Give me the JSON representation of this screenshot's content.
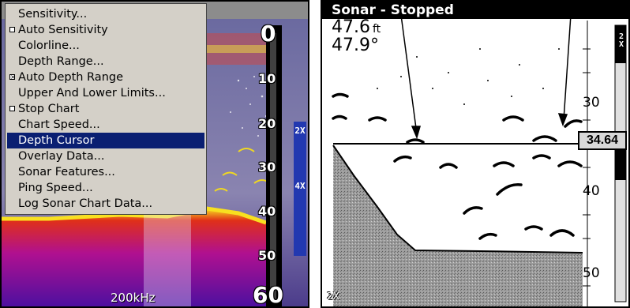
{
  "left": {
    "title": "",
    "menu": {
      "items": [
        {
          "label": "Sensitivity...",
          "checkbox": "",
          "selected": false
        },
        {
          "label": "Auto Sensitivity",
          "checkbox": "empty",
          "selected": false
        },
        {
          "label": "Colorline...",
          "checkbox": "",
          "selected": false
        },
        {
          "label": "Depth Range...",
          "checkbox": "",
          "selected": false
        },
        {
          "label": "Auto Depth Range",
          "checkbox": "checked",
          "selected": false
        },
        {
          "label": "Upper And Lower Limits...",
          "checkbox": "",
          "selected": false
        },
        {
          "label": "Stop Chart",
          "checkbox": "empty",
          "selected": false
        },
        {
          "label": "Chart Speed...",
          "checkbox": "",
          "selected": false
        },
        {
          "label": "Depth Cursor",
          "checkbox": "",
          "selected": true
        },
        {
          "label": "Overlay Data...",
          "checkbox": "",
          "selected": false
        },
        {
          "label": "Sonar Features...",
          "checkbox": "",
          "selected": false
        },
        {
          "label": "Ping Speed...",
          "checkbox": "",
          "selected": false
        },
        {
          "label": "Log Sonar Chart Data...",
          "checkbox": "",
          "selected": false
        }
      ]
    },
    "scale": {
      "top": "0",
      "marks": [
        "10",
        "20",
        "30",
        "40",
        "50"
      ],
      "bottom": "60"
    },
    "zoom_labels": [
      "2X",
      "4X"
    ],
    "frequency": "200kHz"
  },
  "right": {
    "title": "Sonar - Stopped",
    "depth_readout": "47.6",
    "depth_unit": "ft",
    "temp_readout": "47.9°",
    "scale": [
      "30",
      "40",
      "50"
    ],
    "cursor_value": "34.64",
    "zoom_label": "2X",
    "zoom_indicator": "2X"
  },
  "colors": {
    "menu_background": "#d4d0c8",
    "menu_selected": "#0a1f72",
    "sonar_red": "#d81818",
    "sonar_yellow": "#f8e020",
    "zoom_bar": "#2238b0"
  }
}
